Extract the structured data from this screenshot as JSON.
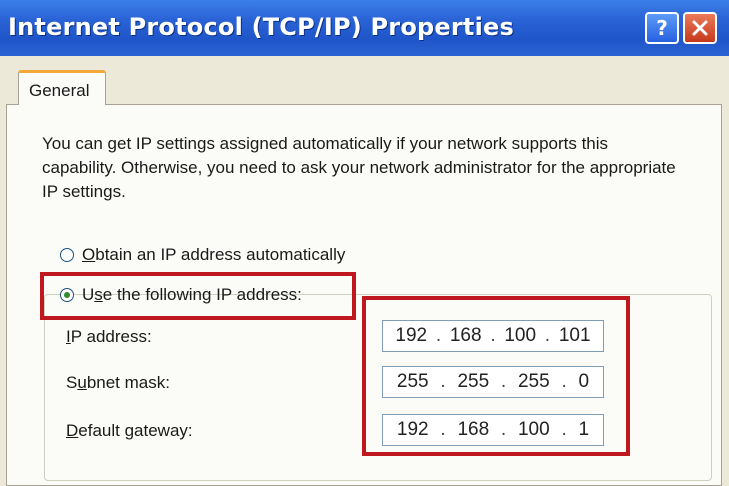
{
  "window": {
    "title": "Internet Protocol (TCP/IP) Properties"
  },
  "tabs": [
    {
      "label": "General",
      "active": true
    }
  ],
  "description": "You can get IP settings assigned automatically if your network supports this capability. Otherwise, you need to ask your network administrator for the appropriate IP settings.",
  "options": {
    "auto": {
      "label_mnemonic": "O",
      "label_rest": "btain an IP address automatically",
      "checked": false
    },
    "manual": {
      "label_pre": "U",
      "label_mnemonic": "s",
      "label_rest": "e the following IP address:",
      "checked": true
    }
  },
  "fields": {
    "ip": {
      "label_mnemonic": "I",
      "label_rest": "P address:",
      "octets": [
        "192",
        "168",
        "100",
        "101"
      ]
    },
    "subnet": {
      "label_pre": "S",
      "label_mnemonic": "u",
      "label_rest": "bnet mask:",
      "octets": [
        "255",
        "255",
        "255",
        "0"
      ]
    },
    "gateway": {
      "label_mnemonic": "D",
      "label_rest": "efault gateway:",
      "octets": [
        "192",
        "168",
        "100",
        "1"
      ]
    }
  },
  "icons": {
    "help": "help-icon",
    "close": "close-icon"
  },
  "colors": {
    "titlebar": "#2a63d6",
    "highlight": "#c0181f",
    "tab_accent": "#f2a93a"
  }
}
